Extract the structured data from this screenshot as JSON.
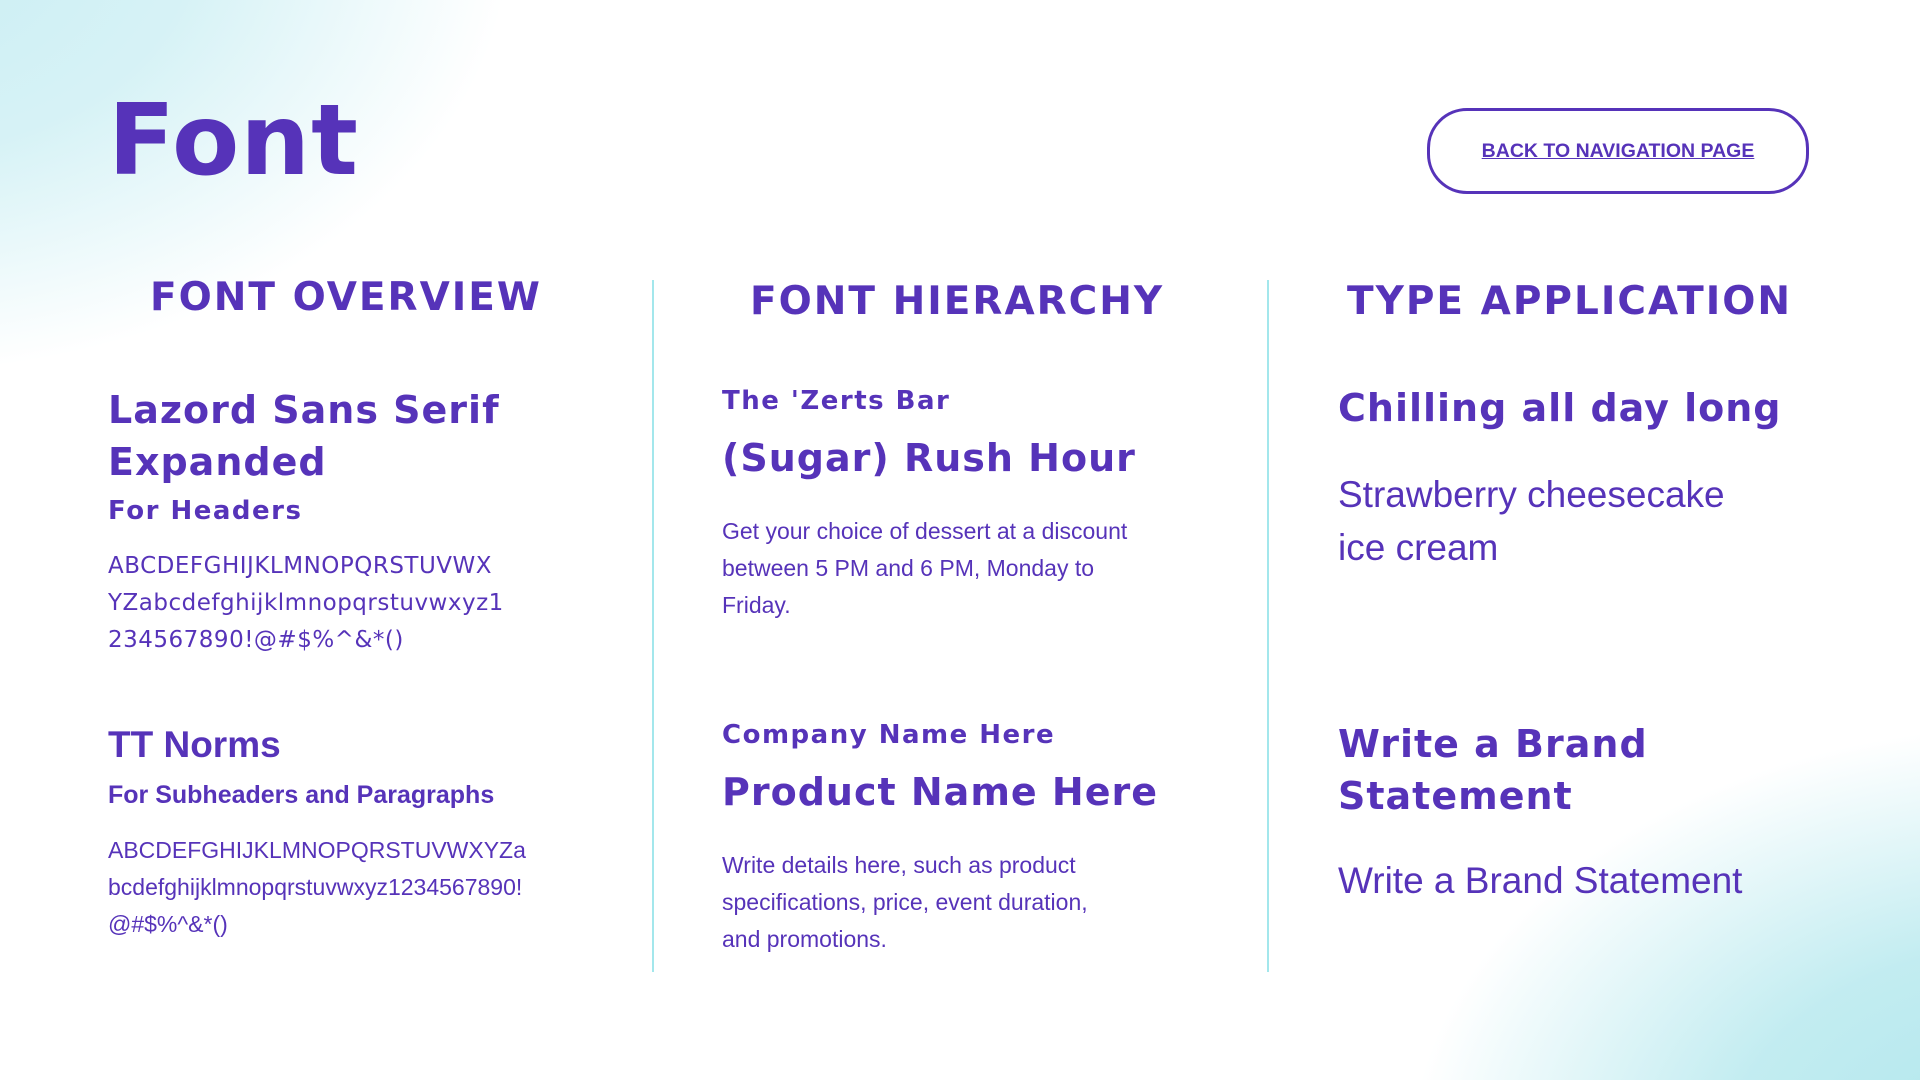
{
  "header": {
    "title": "Font",
    "back_button_label": "BACK TO NAVIGATION PAGE"
  },
  "overview": {
    "heading": "FONT OVERVIEW",
    "primary_font": {
      "name_line1": "Lazord Sans Serif",
      "name_line2": "Expanded",
      "usage": "For Headers",
      "sample_lines": [
        "ABCDEFGHIJKLMNOPQRSTUVWX",
        "YZabcdefghijklmnopqrstuvwxyz1",
        "234567890!@#$%^&*()"
      ]
    },
    "secondary_font": {
      "name": "TT Norms",
      "usage": "For Subheaders and Paragraphs",
      "sample_lines": [
        "ABCDEFGHIJKLMNOPQRSTUVWXYZa",
        "bcdefghijklmnopqrstuvwxyz1234567890!",
        "@#$%^&*()"
      ]
    }
  },
  "hierarchy": {
    "heading": "FONT HIERARCHY",
    "example1": {
      "eyebrow": "The 'Zerts Bar",
      "title": "(Sugar) Rush Hour",
      "body_lines": [
        "Get your choice of dessert at a discount",
        "between 5 PM and 6 PM, Monday to",
        "Friday."
      ]
    },
    "example2": {
      "eyebrow": "Company Name Here",
      "title": "Product Name Here",
      "body_lines": [
        "Write details here, such as product",
        "specifications, price, event duration,",
        "and promotions."
      ]
    }
  },
  "application": {
    "heading": "TYPE APPLICATION",
    "example1": {
      "headline": "Chilling all day long",
      "sub_lines": [
        "Strawberry cheesecake",
        "ice cream"
      ]
    },
    "example2": {
      "headline_lines": [
        "Write a Brand",
        "Statement"
      ],
      "sub": "Write a Brand Statement"
    }
  },
  "colors": {
    "primary_purple": "#5633b9",
    "divider_cyan": "#a3e7ec",
    "gradient_cyan": "#c9eef3"
  }
}
